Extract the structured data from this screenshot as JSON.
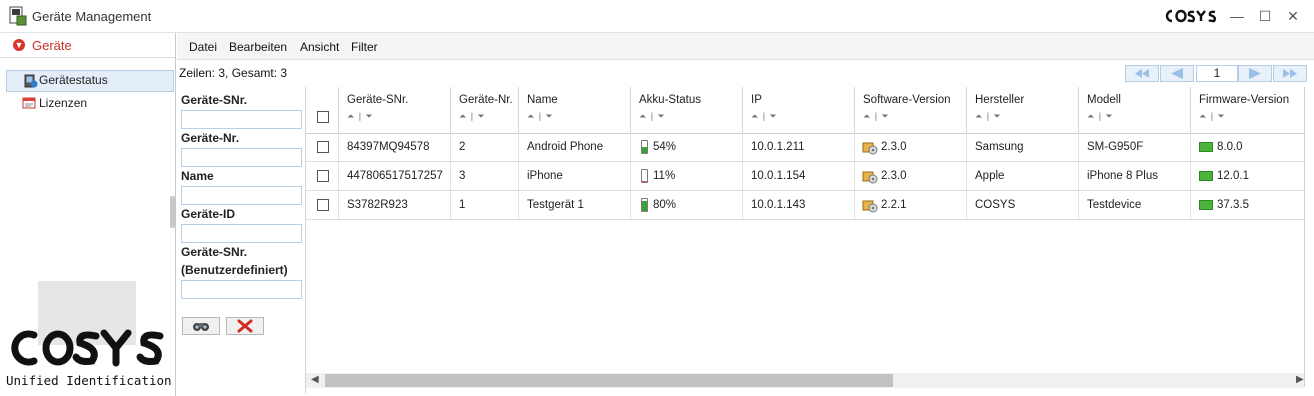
{
  "window": {
    "title": "Geräte Management",
    "brand": "COSYS",
    "minimize_glyph": "—",
    "maximize_glyph": "☐",
    "close_glyph": "✕"
  },
  "nav": {
    "header": "Geräte",
    "items": [
      {
        "label": "Gerätestatus",
        "icon": "device-status-icon",
        "selected": true
      },
      {
        "label": "Lizenzen",
        "icon": "license-icon",
        "selected": false
      }
    ],
    "logo_caption": "Unified Identification"
  },
  "menu": [
    "Datei",
    "Bearbeiten",
    "Ansicht",
    "Filter"
  ],
  "toolbar": {
    "rowcount": "Zeilen: 3, Gesamt: 3",
    "page": "1"
  },
  "filter": {
    "fields": [
      {
        "label": "Geräte-SNr.",
        "value": ""
      },
      {
        "label": "Geräte-Nr.",
        "value": ""
      },
      {
        "label": "Name",
        "value": ""
      },
      {
        "label": "Geräte-ID",
        "value": ""
      },
      {
        "label": "Geräte-SNr. (Benutzerdefiniert)",
        "value": ""
      }
    ],
    "search_icon": "binoculars-icon",
    "clear_icon": "red-x-icon"
  },
  "grid": {
    "sort_indicator": "⏶ | ⏷",
    "columns": [
      "Geräte-SNr.",
      "Geräte-Nr.",
      "Name",
      "Akku-Status",
      "IP",
      "Software-Version",
      "Hersteller",
      "Modell",
      "Firmware-Version"
    ],
    "rows": [
      {
        "snr": "84397MQ94578",
        "nr": "2",
        "name": "Android Phone",
        "akku": "54%",
        "akku_level": 0.54,
        "ip": "10.0.1.211",
        "sw": "2.3.0",
        "hersteller": "Samsung",
        "modell": "SM-G950F",
        "fw": "8.0.0"
      },
      {
        "snr": "447806517517257",
        "nr": "3",
        "name": "iPhone",
        "akku": "11%",
        "akku_level": 0.11,
        "ip": "10.0.1.154",
        "sw": "2.3.0",
        "hersteller": "Apple",
        "modell": "iPhone 8 Plus",
        "fw": "12.0.1"
      },
      {
        "snr": "S3782R923",
        "nr": "1",
        "name": "Testgerät 1",
        "akku": "80%",
        "akku_level": 0.8,
        "ip": "10.0.1.143",
        "sw": "2.2.1",
        "hersteller": "COSYS",
        "modell": "Testdevice",
        "fw": "37.3.5"
      }
    ]
  },
  "colors": {
    "accent_red": "#c83229",
    "selection": "#e4eef8",
    "battery_green": "#3aa335",
    "battery_red": "#d9534f"
  }
}
